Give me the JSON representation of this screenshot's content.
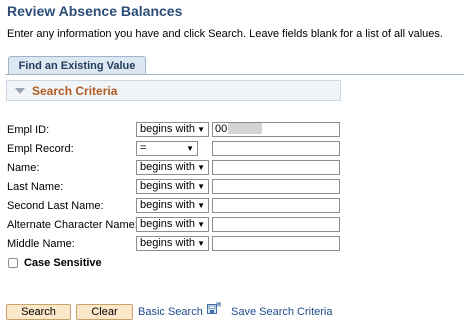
{
  "page": {
    "title": "Review Absence Balances",
    "instructions": "Enter any information you have and click Search. Leave fields blank for a list of all values."
  },
  "tabs": {
    "find_existing": "Find an Existing Value"
  },
  "criteria": {
    "header": "Search Criteria",
    "fields": [
      {
        "label": "Empl ID:",
        "operator": "begins with",
        "value": "00"
      },
      {
        "label": "Empl Record:",
        "operator": "=",
        "value": ""
      },
      {
        "label": "Name:",
        "operator": "begins with",
        "value": ""
      },
      {
        "label": "Last Name:",
        "operator": "begins with",
        "value": ""
      },
      {
        "label": "Second Last Name:",
        "operator": "begins with",
        "value": ""
      },
      {
        "label": "Alternate Character Name:",
        "operator": "begins with",
        "value": ""
      },
      {
        "label": "Middle Name:",
        "operator": "begins with",
        "value": ""
      }
    ],
    "case_sensitive_label": "Case Sensitive",
    "case_sensitive_checked": false
  },
  "actions": {
    "search": "Search",
    "clear": "Clear",
    "basic_search": "Basic Search",
    "save_search": "Save Search Criteria"
  },
  "icons": {
    "dropdown": "chevron-down-icon",
    "save_criteria": "save-criteria-icon",
    "collapse": "collapse-triangle-icon"
  },
  "colors": {
    "title": "#2b4d78",
    "criteria_header": "#b15a22",
    "button_bg": "#fbe7c9",
    "link": "#1e4b8a"
  }
}
